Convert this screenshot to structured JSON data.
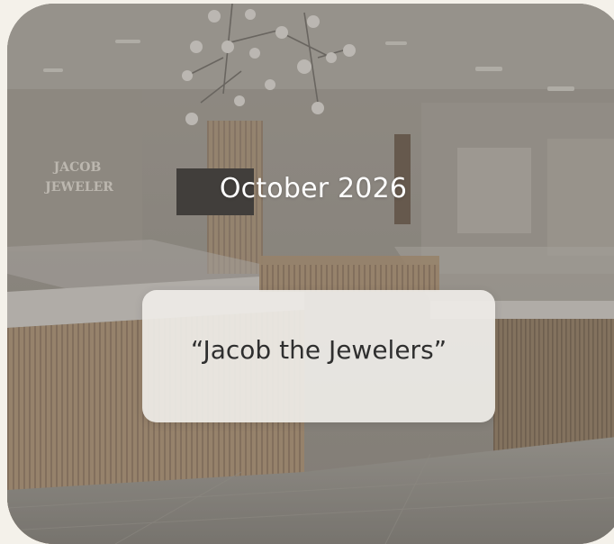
{
  "background": {
    "signage": [
      "JACOB",
      "JEWELER"
    ]
  },
  "header": {
    "month_label": "October 2026"
  },
  "title_card": {
    "text": "“Jacob the Jewelers”"
  },
  "colors": {
    "page_background": "#f4f1ea",
    "card_text": "#2f2f2f",
    "month_text": "#ffffff"
  }
}
